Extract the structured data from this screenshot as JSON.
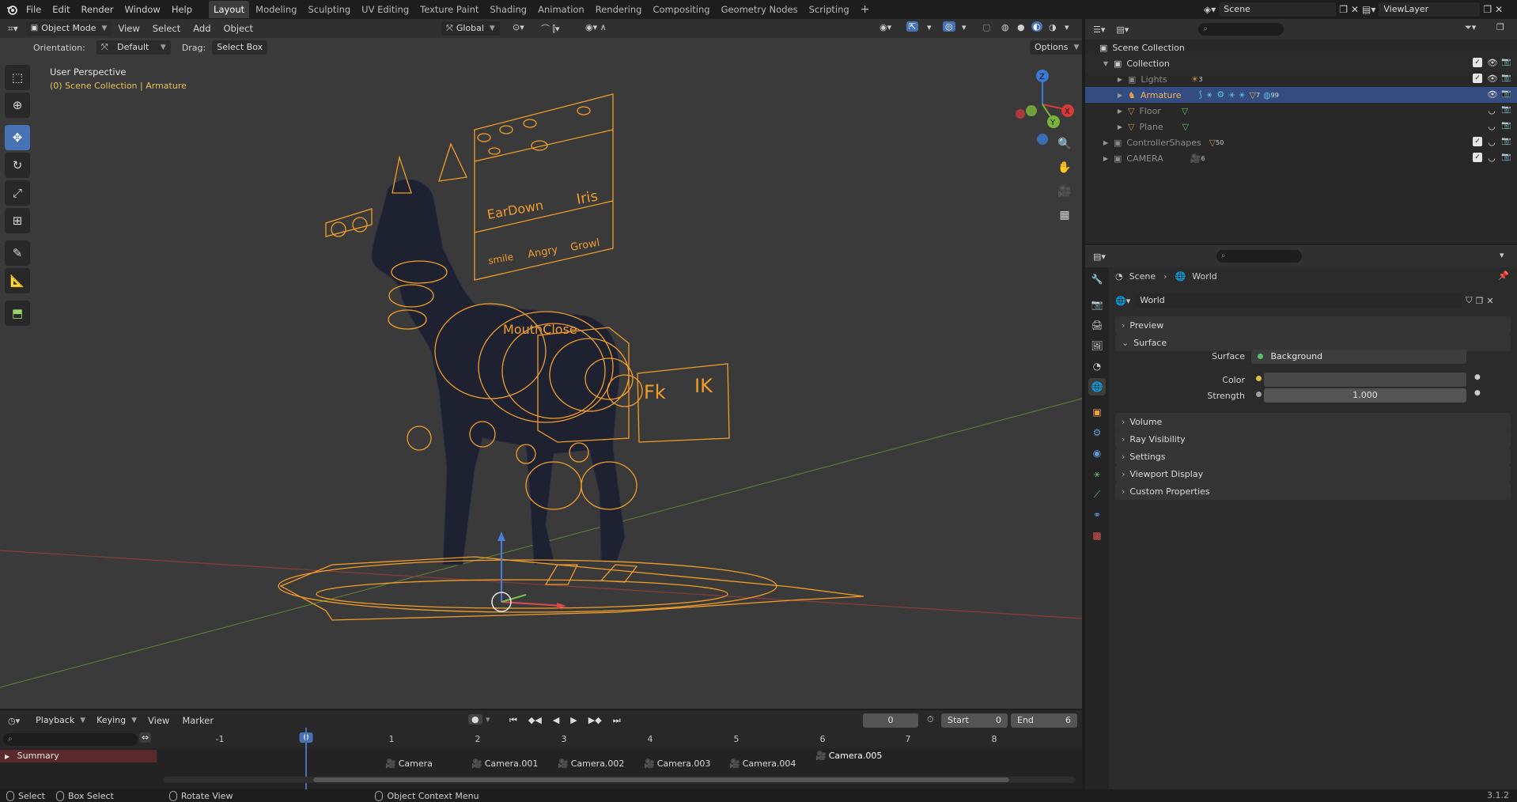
{
  "menu": {
    "items": [
      "File",
      "Edit",
      "Render",
      "Window",
      "Help"
    ],
    "workspaces": [
      "Layout",
      "Modeling",
      "Sculpting",
      "UV Editing",
      "Texture Paint",
      "Shading",
      "Animation",
      "Rendering",
      "Compositing",
      "Geometry Nodes",
      "Scripting"
    ],
    "active_workspace": "Layout",
    "add_tab": "+",
    "scene_name": "Scene",
    "view_layer": "ViewLayer"
  },
  "viewport": {
    "mode": "Object Mode",
    "menus": [
      "View",
      "Select",
      "Add",
      "Object"
    ],
    "transform_orientation": "Global",
    "orientation_label": "Orientation:",
    "orientation_value": "Default",
    "drag_label": "Drag:",
    "drag_value": "Select Box",
    "options_label": "Options",
    "perspective_label": "User Perspective",
    "collection_path": "(0) Scene Collection | Armature",
    "rig_labels": {
      "ear_down": "EarDown",
      "iris": "Iris",
      "smile": "smile",
      "angry": "Angry",
      "growl": "Growl",
      "mouth_close": "MouthClose",
      "fk": "Fk",
      "ik": "IK"
    },
    "gizmo": {
      "x": "X",
      "y": "Y",
      "z": "Z"
    },
    "colors": {
      "rig_orange": "#f29d2a",
      "background": "#3a3a3a",
      "x_axis": "#d33a3a",
      "y_axis": "#7ab33a",
      "z_axis": "#3a7ad3"
    }
  },
  "timeline": {
    "menus": [
      "Playback",
      "Keying",
      "View",
      "Marker"
    ],
    "current_frame": "0",
    "start_label": "Start",
    "start_value": "0",
    "end_label": "End",
    "end_value": "6",
    "ruler_frames": [
      "-1",
      "0",
      "1",
      "2",
      "3",
      "4",
      "5",
      "6",
      "7",
      "8"
    ],
    "summary_label": "Summary",
    "markers": [
      "Camera",
      "Camera.001",
      "Camera.002",
      "Camera.003",
      "Camera.004",
      "Camera.005"
    ]
  },
  "statusbar": {
    "select": "Select",
    "box_select": "Box Select",
    "rotate_view": "Rotate View",
    "context_menu": "Object Context Menu",
    "version": "3.1.2"
  },
  "outliner": {
    "rows": [
      {
        "label": "Scene Collection",
        "indent": 0,
        "badge": ""
      },
      {
        "label": "Collection",
        "indent": 1,
        "badge": ""
      },
      {
        "label": "Lights",
        "indent": 2,
        "badge": "3"
      },
      {
        "label": "Armature",
        "indent": 2,
        "badge": "99"
      },
      {
        "label": "Floor",
        "indent": 2,
        "badge": ""
      },
      {
        "label": "Plane",
        "indent": 2,
        "badge": ""
      },
      {
        "label": "ControllerShapes",
        "indent": 1,
        "badge": "50"
      },
      {
        "label": "CAMERA",
        "indent": 1,
        "badge": "6"
      }
    ],
    "armature_extra_badge": "7"
  },
  "properties": {
    "breadcrumb_scene": "Scene",
    "breadcrumb_world": "World",
    "world_name": "World",
    "panels": [
      "Preview",
      "Surface",
      "Volume",
      "Ray Visibility",
      "Settings",
      "Viewport Display",
      "Custom Properties"
    ],
    "surface_label": "Surface",
    "surface_value": "Background",
    "color_label": "Color",
    "strength_label": "Strength",
    "strength_value": "1.000"
  }
}
